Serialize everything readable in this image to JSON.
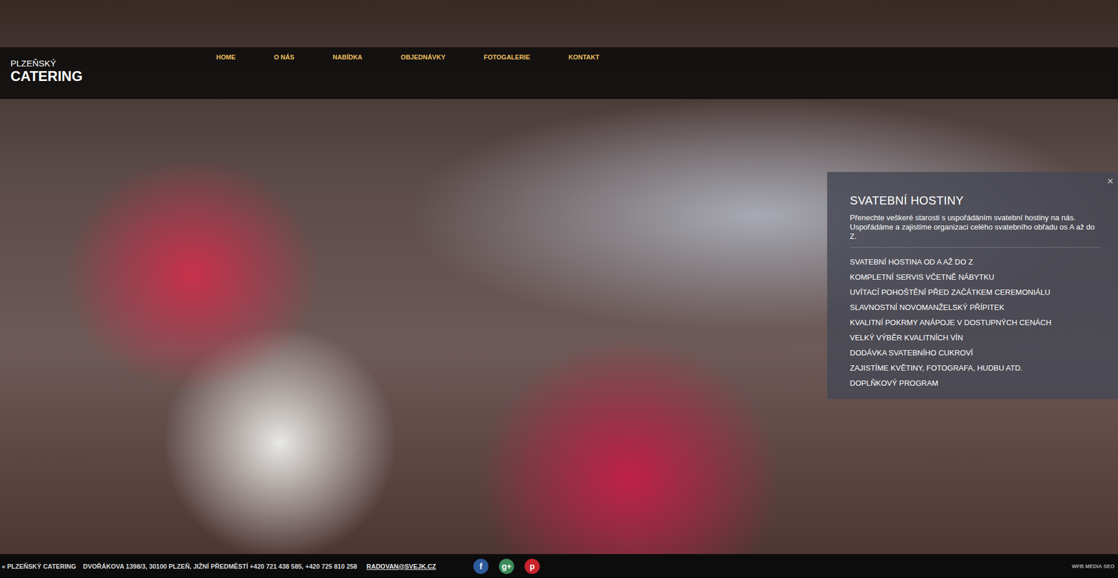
{
  "logo": {
    "line1": "PLZEŇSKÝ",
    "line2": "CATERING"
  },
  "nav": [
    {
      "label": "HOME",
      "selected": false
    },
    {
      "label": "O NÁS",
      "selected": false
    },
    {
      "label": "NABÍDKA",
      "selected": false
    },
    {
      "label": "OBJEDNÁVKY",
      "selected": false
    },
    {
      "label": "FOTOGALERIE",
      "selected": false
    },
    {
      "label": "KONTAKT",
      "selected": false
    }
  ],
  "panel": {
    "close": "×",
    "title": "SVATEBNÍ HOSTINY",
    "text": "Přenechte veškeré starosti s uspořádáním svatební hostiny na nás. Uspořádáme a zajistíme organizaci celého svatebního obřadu os A až do Z.",
    "items": [
      "SVATEBNÍ HOSTINA OD A AŽ DO Z",
      "KOMPLETNÍ SERVIS VČETNĚ NÁBYTKU",
      "UVÍTACÍ POHOŠTĚNÍ PŘED ZAČÁTKEM CEREMONIÁLU",
      "SLAVNOSTNÍ NOVOMANŽELSKÝ PŘÍPITEK",
      "KVALITNÍ POKRMY ANÁPOJE V DOSTUPNÝCH CENÁCH",
      "VELKÝ VÝBĚR KVALITNÍCH VÍN",
      "DODÁVKA SVATEBNÍHO CUKROVÍ",
      "ZAJISTÍME KVĚTINY, FOTOGRAFA, HUDBU ATD.",
      "DOPLŇKOVÝ PROGRAM"
    ]
  },
  "footer": {
    "brand": "« PLZEŇSKÝ CATERING",
    "address": "DVOŘÁKOVA 1398/3, 30100 PLZEŇ, JIŽNÍ PŘEDMĚSTÍ +420 721 438 585, +420 725 810 258",
    "email": "RADOVAN@SVEJK.CZ",
    "social": [
      {
        "name": "facebook",
        "glyph": "f",
        "color": "#2d5a9a"
      },
      {
        "name": "google-plus",
        "glyph": "g+",
        "color": "#3a8a5a"
      },
      {
        "name": "pinterest",
        "glyph": "p",
        "color": "#c8232c"
      }
    ],
    "credit": "WFB MEDIA SEO"
  }
}
